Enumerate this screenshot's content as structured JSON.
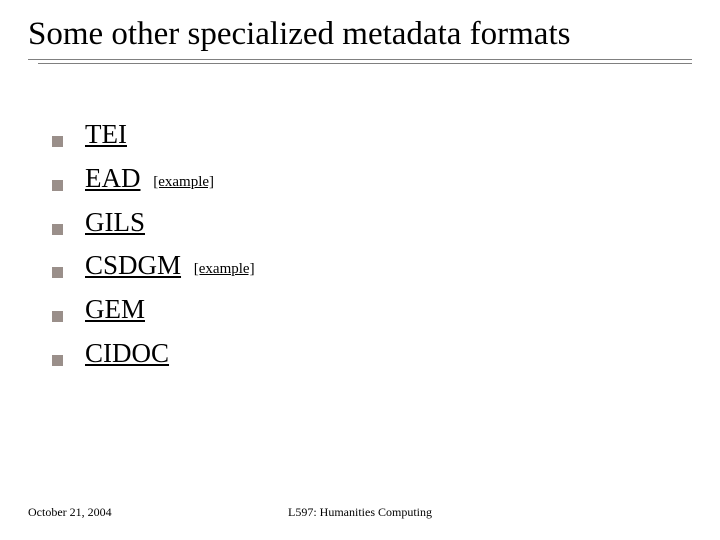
{
  "title": "Some other specialized metadata formats",
  "items": [
    {
      "label": "TEI",
      "example": null
    },
    {
      "label": "EAD",
      "example": "[example]"
    },
    {
      "label": "GILS",
      "example": null
    },
    {
      "label": "CSDGM",
      "example": "[example]"
    },
    {
      "label": "GEM",
      "example": null
    },
    {
      "label": "CIDOC",
      "example": null
    }
  ],
  "footer": {
    "date": "October 21, 2004",
    "course": "L597: Humanities Computing"
  }
}
